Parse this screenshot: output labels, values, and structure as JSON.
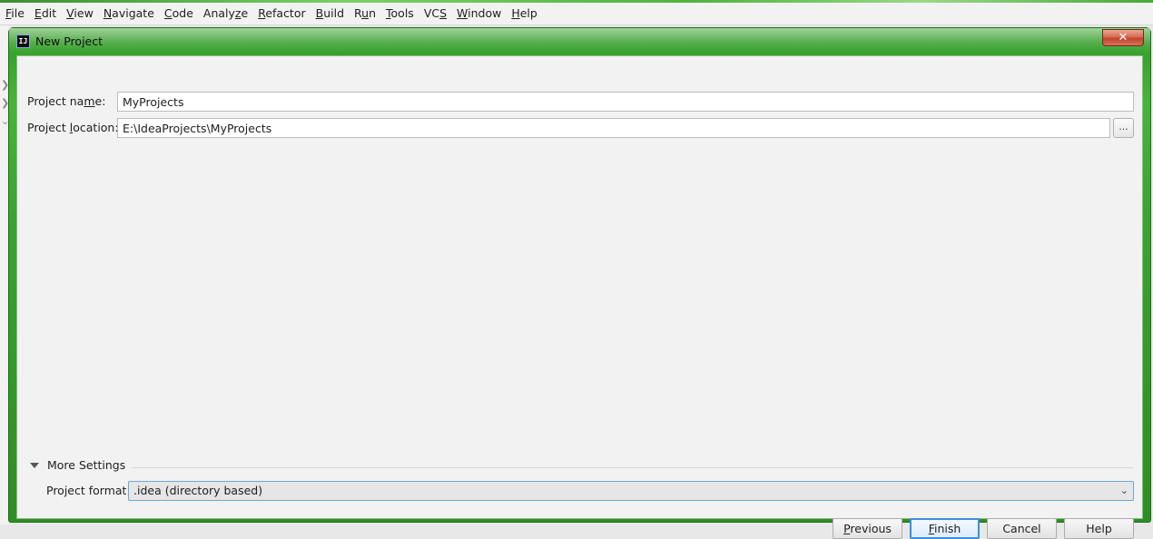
{
  "menubar": {
    "items": [
      {
        "mn": "F",
        "rest": "ile"
      },
      {
        "mn": "E",
        "rest": "dit"
      },
      {
        "mn": "V",
        "rest": "iew"
      },
      {
        "mn": "N",
        "rest": "avigate"
      },
      {
        "mn": "C",
        "rest": "ode"
      },
      {
        "pre": "Analy",
        "mn": "z",
        "rest": "e"
      },
      {
        "mn": "R",
        "rest": "efactor"
      },
      {
        "mn": "B",
        "rest": "uild"
      },
      {
        "pre": "R",
        "mn": "u",
        "rest": "n"
      },
      {
        "mn": "T",
        "rest": "ools"
      },
      {
        "pre": "VC",
        "mn": "S",
        "rest": ""
      },
      {
        "mn": "W",
        "rest": "indow"
      },
      {
        "mn": "H",
        "rest": "elp"
      }
    ]
  },
  "ide_strip": {
    "marks": [
      "❯",
      "❯",
      "⌄"
    ]
  },
  "dialog": {
    "title": "New Project",
    "icon_text": "IJ",
    "close_glyph": "✕",
    "project_name": {
      "label_pre": "Project na",
      "label_mn": "m",
      "label_post": "e:",
      "value": "MyProjects"
    },
    "project_location": {
      "label_pre": "Project ",
      "label_mn": "l",
      "label_post": "ocation:",
      "value": "E:\\IdeaProjects\\MyProjects",
      "browse_label": "..."
    },
    "more_settings": {
      "label": "More Settings"
    },
    "project_format": {
      "label": "Project format:",
      "value": ".idea (directory based)",
      "arrow": "⌄"
    },
    "buttons": {
      "previous": {
        "mn": "P",
        "rest": "revious"
      },
      "finish": {
        "mn": "F",
        "rest": "inish"
      },
      "cancel": "Cancel",
      "help": "Help"
    }
  },
  "colors": {
    "accent_blue": "#3a8ee0",
    "frame_green": "#3aa32e",
    "dialog_bg": "#f2f2f2"
  }
}
